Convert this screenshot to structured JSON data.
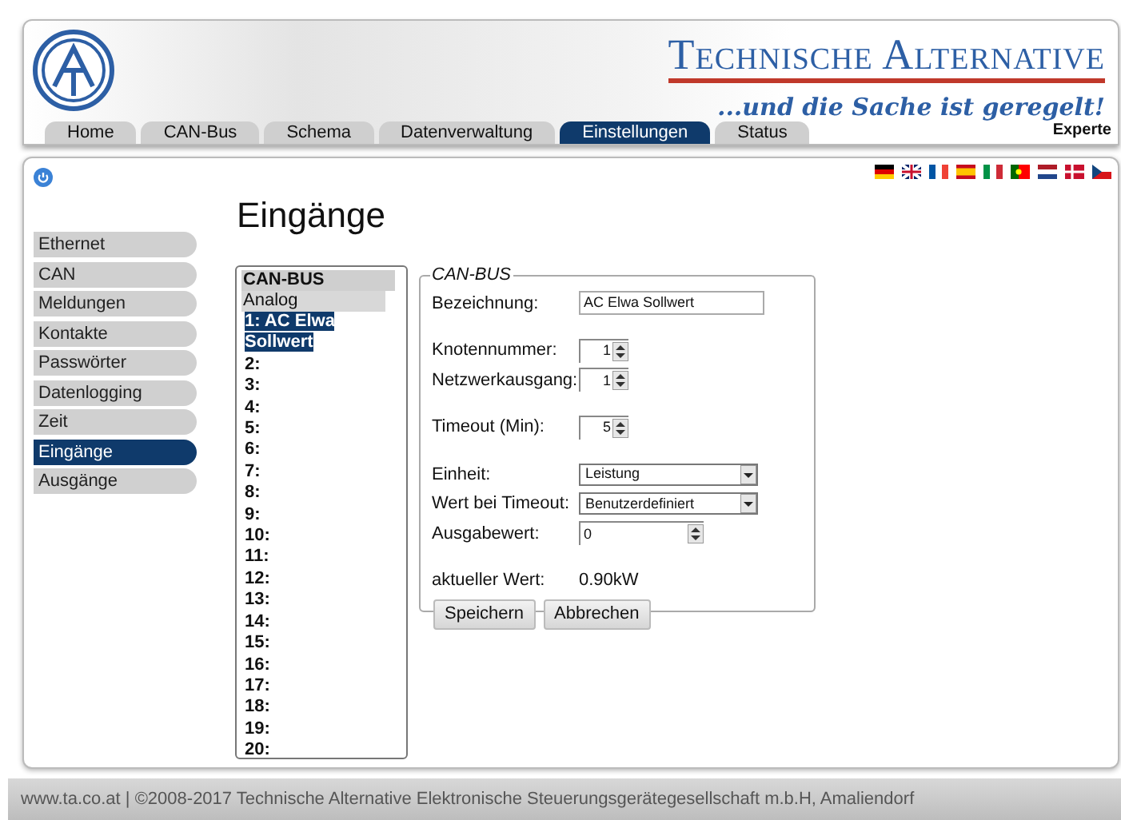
{
  "header": {
    "brand": "Technische Alternative",
    "slogan": "...und die Sache ist geregelt!",
    "user_level": "Experte"
  },
  "tabs": [
    {
      "label": "Home",
      "selected": false
    },
    {
      "label": "CAN-Bus",
      "selected": false
    },
    {
      "label": "Schema",
      "selected": false
    },
    {
      "label": "Datenverwaltung",
      "selected": false
    },
    {
      "label": "Einstellungen",
      "selected": true
    },
    {
      "label": "Status",
      "selected": false
    }
  ],
  "sidebar": {
    "items": [
      {
        "label": "Ethernet",
        "selected": false
      },
      {
        "label": "CAN",
        "selected": false
      },
      {
        "label": "Meldungen",
        "selected": false
      },
      {
        "label": "Kontakte",
        "selected": false
      },
      {
        "label": "Passwörter",
        "selected": false
      },
      {
        "label": "Datenlogging",
        "selected": false
      },
      {
        "label": "Zeit",
        "selected": false
      },
      {
        "label": "Eingänge",
        "selected": true
      },
      {
        "label": "Ausgänge",
        "selected": false
      }
    ]
  },
  "page_title": "Eingänge",
  "input_list": [
    {
      "kind": "header",
      "label": "CAN-BUS",
      "selected": false
    },
    {
      "kind": "category",
      "label": "Analog",
      "selected": false
    },
    {
      "kind": "item",
      "label": "1: AC Elwa Sollwert",
      "selected": true
    },
    {
      "kind": "item",
      "label": "2:",
      "selected": false
    },
    {
      "kind": "item",
      "label": "3:",
      "selected": false
    },
    {
      "kind": "item",
      "label": "4:",
      "selected": false
    },
    {
      "kind": "item",
      "label": "5:",
      "selected": false
    },
    {
      "kind": "item",
      "label": "6:",
      "selected": false
    },
    {
      "kind": "item",
      "label": "7:",
      "selected": false
    },
    {
      "kind": "item",
      "label": "8:",
      "selected": false
    },
    {
      "kind": "item",
      "label": "9:",
      "selected": false
    },
    {
      "kind": "item",
      "label": "10:",
      "selected": false
    },
    {
      "kind": "item",
      "label": "11:",
      "selected": false
    },
    {
      "kind": "item",
      "label": "12:",
      "selected": false
    },
    {
      "kind": "item",
      "label": "13:",
      "selected": false
    },
    {
      "kind": "item",
      "label": "14:",
      "selected": false
    },
    {
      "kind": "item",
      "label": "15:",
      "selected": false
    },
    {
      "kind": "item",
      "label": "16:",
      "selected": false
    },
    {
      "kind": "item",
      "label": "17:",
      "selected": false
    },
    {
      "kind": "item",
      "label": "18:",
      "selected": false
    },
    {
      "kind": "item",
      "label": "19:",
      "selected": false
    },
    {
      "kind": "item",
      "label": "20:",
      "selected": false
    }
  ],
  "settings": {
    "legend": "CAN-BUS",
    "groups": [
      [
        {
          "kind": "text",
          "label": "Bezeichnung:",
          "value": "AC Elwa Sollwert"
        }
      ],
      [
        {
          "kind": "spin",
          "label": "Knotennummer:",
          "value": "1"
        },
        {
          "kind": "spin",
          "label": "Netzwerkausgang:",
          "value": "1"
        }
      ],
      [
        {
          "kind": "spin",
          "label": "Timeout (Min):",
          "value": "5"
        }
      ],
      [
        {
          "kind": "select",
          "label": "Einheit:",
          "value": "Leistung"
        },
        {
          "kind": "select",
          "label": "Wert bei Timeout:",
          "value": "Benutzerdefiniert"
        },
        {
          "kind": "wide_spin",
          "label": "Ausgabewert:",
          "value": "0"
        }
      ],
      [
        {
          "kind": "readout",
          "label": "aktueller Wert:",
          "value": "0.90kW"
        }
      ]
    ]
  },
  "buttons": [
    "Speichern",
    "Abbrechen"
  ],
  "footer": "www.ta.co.at | ©2008-2017 Technische Alternative Elektronische Steuerungsgerätegesellschaft m.b.H, Amaliendorf"
}
